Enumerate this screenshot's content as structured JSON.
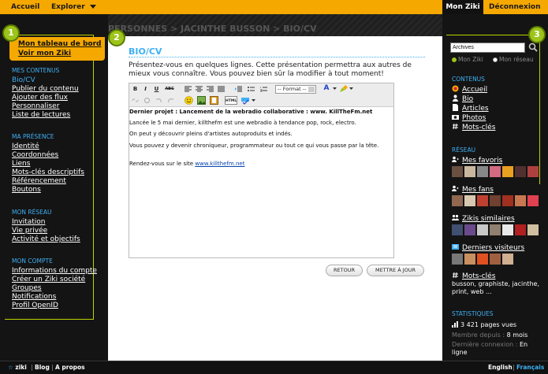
{
  "topbar": {
    "accueil": "Accueil",
    "explorer": "Explorer",
    "mon_ziki": "Mon Ziki",
    "deconnexion": "Déconnexion"
  },
  "badges": [
    "1",
    "2",
    "3"
  ],
  "breadcrumb": "PERSONNES > JACINTHE BUSSON > BIO/CV",
  "left": {
    "tabs": [
      "Mon tableau de bord",
      "Voir mon Ziki"
    ],
    "sections": [
      {
        "title": "MES CONTENUS",
        "items": [
          "Bio/CV",
          "Publier du contenu",
          "Ajouter des flux",
          "Personnaliser",
          "Liste de lectures"
        ]
      },
      {
        "title": "MA PRÉSENCE",
        "items": [
          "Identité",
          "Coordonnées",
          "Liens",
          "Mots-clés descriptifs",
          "Référencement",
          "Boutons"
        ]
      },
      {
        "title": "MON RÉSEAU",
        "items": [
          "Invitation",
          "Vie privée",
          "Activité et objectifs"
        ]
      },
      {
        "title": "MON COMPTE",
        "items": [
          "Informations du compte",
          "Créer un Ziki société",
          "Groupes",
          "Notifications",
          "Profil OpenID"
        ]
      }
    ]
  },
  "main": {
    "title": "BIO/CV",
    "intro": "Présentez-vous en quelques lignes. Cette présentation permettra aux autres de mieux vous connaître. Vous pouvez bien sûr la modifier à tout moment!",
    "toolbar": {
      "bold": "B",
      "italic": "I",
      "underline": "U",
      "strike": "ABC",
      "format": "-- Format --",
      "font_color": "A",
      "html": "HTML"
    },
    "editor": {
      "p1": "Dernier projet : Lancement de la webradio collaborative :  www. KillTheFm.net",
      "p2": "Lancée le 5 mai dernier, killthefm est une webradio à tendance pop, rock, electro.",
      "p3": "On peut y découvrir pleins d'artistes autoproduits et indés.",
      "p4": "Vous pouvez y devenir chroniqueur, programmateur ou tout ce qui vous passe par la tête.",
      "p5_prefix": "Rendez-vous sur le site ",
      "p5_link": "www.killthefm.net"
    },
    "buttons": {
      "retour": "RETOUR",
      "maj": "METTRE À JOUR"
    }
  },
  "right": {
    "search_value": "Archives",
    "radios": [
      "Mon Ziki",
      "Mon réseau"
    ],
    "contenus_title": "CONTENUS",
    "contenus": [
      "Accueil",
      "Bio",
      "Articles",
      "Photos",
      "Mots-clés"
    ],
    "reseau_title": "RÉSEAU",
    "reseau_groups": [
      "Mes favoris",
      "Mes fans",
      "Zikis similaires",
      "Derniers visiteurs"
    ],
    "motscles_title": "Mots-clés",
    "tags": "busson, graphiste, jacinthe, print, web ...",
    "stats_title": "STATISTIQUES",
    "pages_vues": "3 421 pages vues",
    "membre_label": "Membre depuis : ",
    "membre_value": "8 mois",
    "connexion_label": "Dernière connexion : ",
    "connexion_value": "En ligne"
  },
  "footer": {
    "logo": "ziki",
    "blog": "Blog",
    "apropos": "A propos",
    "english": "English",
    "francais": "Français"
  },
  "colors": {
    "accent": "#f5a800",
    "link_blue": "#3fb0f5",
    "badge_green": "#9dc41a"
  }
}
